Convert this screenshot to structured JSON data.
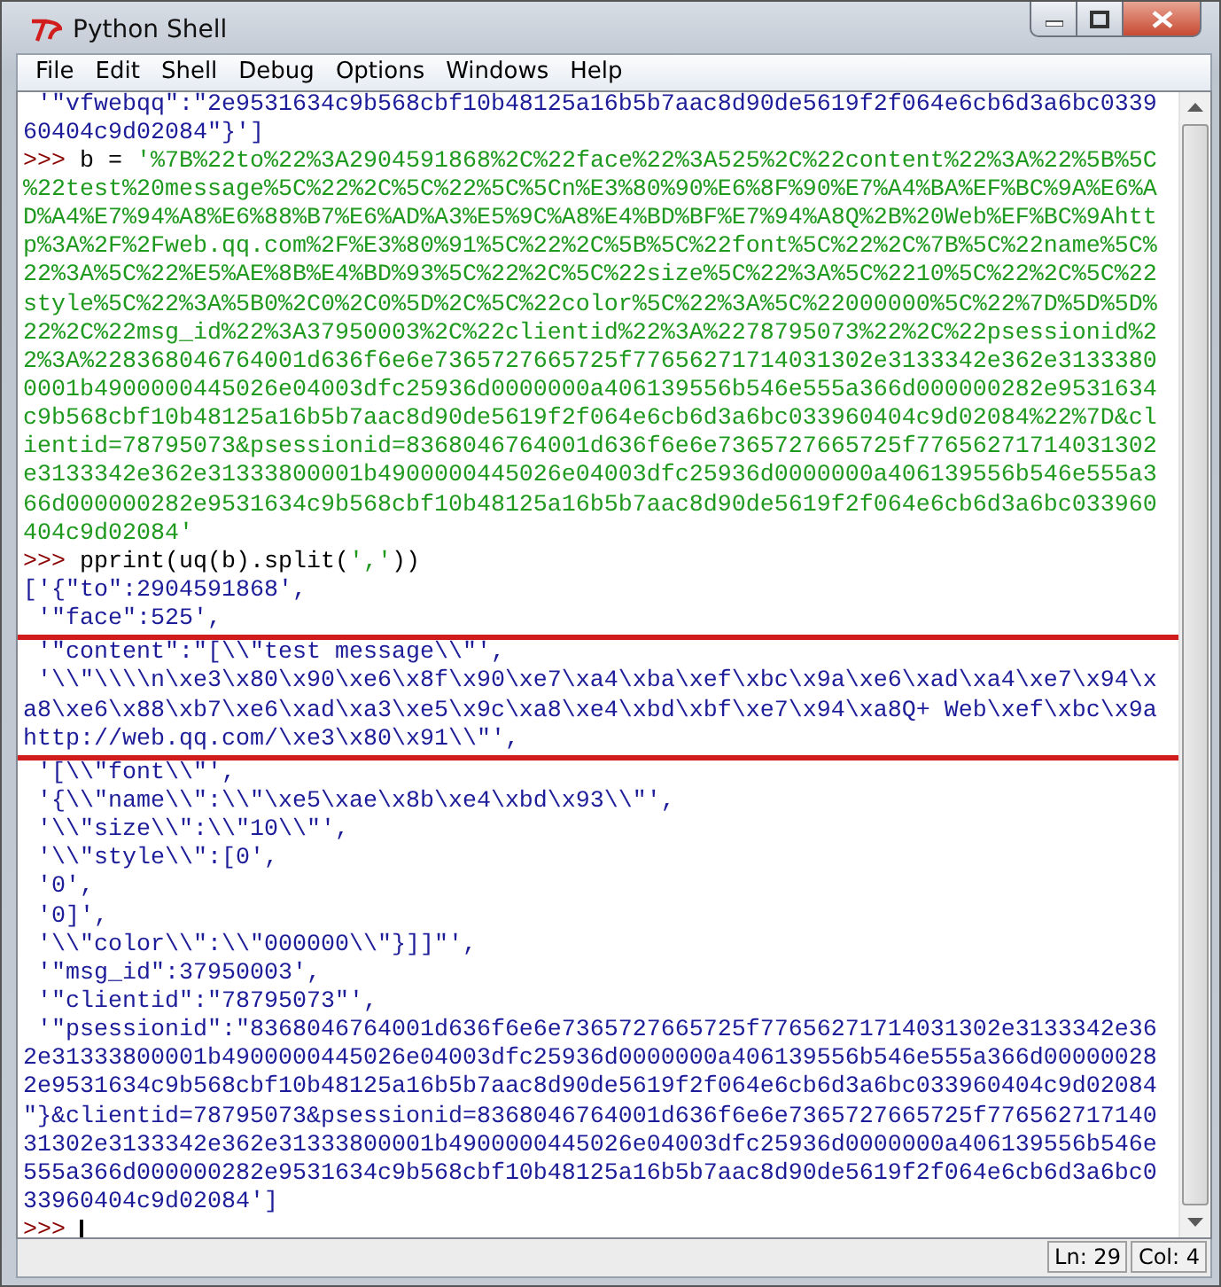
{
  "window": {
    "title": "Python Shell",
    "controls": [
      {
        "kind": "minimize"
      },
      {
        "kind": "maximize"
      },
      {
        "kind": "close"
      }
    ]
  },
  "menu": [
    {
      "label": "File"
    },
    {
      "label": "Edit"
    },
    {
      "label": "Shell"
    },
    {
      "label": "Debug"
    },
    {
      "label": "Options"
    },
    {
      "label": "Windows"
    },
    {
      "label": "Help"
    }
  ],
  "shell": {
    "lines": [
      {
        "parts": [
          {
            "kind": "stdout",
            "text": " '\"vfwebqq\":\"2e9531634c9b568cbf10b48125a16b5b7aac8d90de5619f2f064e6cb6d3a6bc0339"
          }
        ],
        "highlighted": false
      },
      {
        "parts": [
          {
            "kind": "stdout",
            "text": "60404c9d02084\"}']"
          }
        ],
        "highlighted": false
      },
      {
        "prompt": ">>>",
        "parts": [
          {
            "kind": "code",
            "text": "b = "
          },
          {
            "kind": "string",
            "text": "'%7B%22to%22%3A2904591868%2C%22face%22%3A525%2C%22content%22%3A%22%5B%5C"
          }
        ],
        "highlighted": false
      },
      {
        "parts": [
          {
            "kind": "string",
            "text": "%22test%20message%5C%22%2C%5C%22%5C%5Cn%E3%80%90%E6%8F%90%E7%A4%BA%EF%BC%9A%E6%A"
          }
        ],
        "highlighted": false
      },
      {
        "parts": [
          {
            "kind": "string",
            "text": "D%A4%E7%94%A8%E6%88%B7%E6%AD%A3%E5%9C%A8%E4%BD%BF%E7%94%A8Q%2B%20Web%EF%BC%9Ahtt"
          }
        ],
        "highlighted": false
      },
      {
        "parts": [
          {
            "kind": "string",
            "text": "p%3A%2F%2Fweb.qq.com%2F%E3%80%91%5C%22%2C%5B%5C%22font%5C%22%2C%7B%5C%22name%5C%"
          }
        ],
        "highlighted": false
      },
      {
        "parts": [
          {
            "kind": "string",
            "text": "22%3A%5C%22%E5%AE%8B%E4%BD%93%5C%22%2C%5C%22size%5C%22%3A%5C%2210%5C%22%2C%5C%22"
          }
        ],
        "highlighted": false
      },
      {
        "parts": [
          {
            "kind": "string",
            "text": "style%5C%22%3A%5B0%2C0%2C0%5D%2C%5C%22color%5C%22%3A%5C%22000000%5C%22%7D%5D%5D%"
          }
        ],
        "highlighted": false
      },
      {
        "parts": [
          {
            "kind": "string",
            "text": "22%2C%22msg_id%22%3A37950003%2C%22clientid%22%3A%2278795073%22%2C%22psessionid%2"
          }
        ],
        "highlighted": false
      },
      {
        "parts": [
          {
            "kind": "string",
            "text": "2%3A%228368046764001d636f6e6e7365727665725f77656271714031302e3133342e362e3133380"
          }
        ],
        "highlighted": false
      },
      {
        "parts": [
          {
            "kind": "string",
            "text": "0001b4900000445026e04003dfc25936d0000000a406139556b546e555a366d000000282e9531634"
          }
        ],
        "highlighted": false
      },
      {
        "parts": [
          {
            "kind": "string",
            "text": "c9b568cbf10b48125a16b5b7aac8d90de5619f2f064e6cb6d3a6bc033960404c9d02084%22%7D&cl"
          }
        ],
        "highlighted": false
      },
      {
        "parts": [
          {
            "kind": "string",
            "text": "ientid=78795073&psessionid=8368046764001d636f6e6e7365727665725f77656271714031302"
          }
        ],
        "highlighted": false
      },
      {
        "parts": [
          {
            "kind": "string",
            "text": "e3133342e362e31333800001b4900000445026e04003dfc25936d0000000a406139556b546e555a3"
          }
        ],
        "highlighted": false
      },
      {
        "parts": [
          {
            "kind": "string",
            "text": "66d000000282e9531634c9b568cbf10b48125a16b5b7aac8d90de5619f2f064e6cb6d3a6bc033960"
          }
        ],
        "highlighted": false
      },
      {
        "parts": [
          {
            "kind": "string",
            "text": "404c9d02084'"
          }
        ],
        "highlighted": false
      },
      {
        "prompt": ">>>",
        "parts": [
          {
            "kind": "code",
            "text": "pprint(uq(b).split("
          },
          {
            "kind": "string",
            "text": "','"
          },
          {
            "kind": "code",
            "text": "))"
          }
        ],
        "highlighted": false
      },
      {
        "parts": [
          {
            "kind": "stdout",
            "text": "['{\"to\":2904591868',"
          }
        ],
        "highlighted": false
      },
      {
        "parts": [
          {
            "kind": "stdout",
            "text": " '\"face\":525',"
          }
        ],
        "highlighted": false
      },
      {
        "parts": [
          {
            "kind": "stdout",
            "text": " '\"content\":\"[\\\\\"test message\\\\\"',"
          }
        ],
        "highlighted": true
      },
      {
        "parts": [
          {
            "kind": "stdout",
            "text": " '\\\\\"\\\\\\\\n\\xe3\\x80\\x90\\xe6\\x8f\\x90\\xe7\\xa4\\xba\\xef\\xbc\\x9a\\xe6\\xad\\xa4\\xe7\\x94\\x"
          }
        ],
        "highlighted": true
      },
      {
        "parts": [
          {
            "kind": "stdout",
            "text": "a8\\xe6\\x88\\xb7\\xe6\\xad\\xa3\\xe5\\x9c\\xa8\\xe4\\xbd\\xbf\\xe7\\x94\\xa8Q+ Web\\xef\\xbc\\x9a"
          }
        ],
        "highlighted": true
      },
      {
        "parts": [
          {
            "kind": "stdout",
            "text": "http://web.qq.com/\\xe3\\x80\\x91\\\\\"',"
          }
        ],
        "highlighted": true
      },
      {
        "parts": [
          {
            "kind": "stdout",
            "text": " '[\\\\\"font\\\\\"',"
          }
        ],
        "highlighted": false
      },
      {
        "parts": [
          {
            "kind": "stdout",
            "text": " '{\\\\\"name\\\\\":\\\\\"\\xe5\\xae\\x8b\\xe4\\xbd\\x93\\\\\"',"
          }
        ],
        "highlighted": false
      },
      {
        "parts": [
          {
            "kind": "stdout",
            "text": " '\\\\\"size\\\\\":\\\\\"10\\\\\"',"
          }
        ],
        "highlighted": false
      },
      {
        "parts": [
          {
            "kind": "stdout",
            "text": " '\\\\\"style\\\\\":[0',"
          }
        ],
        "highlighted": false
      },
      {
        "parts": [
          {
            "kind": "stdout",
            "text": " '0',"
          }
        ],
        "highlighted": false
      },
      {
        "parts": [
          {
            "kind": "stdout",
            "text": " '0]',"
          }
        ],
        "highlighted": false
      },
      {
        "parts": [
          {
            "kind": "stdout",
            "text": " '\\\\\"color\\\\\":\\\\\"000000\\\\\"}]]\"',"
          }
        ],
        "highlighted": false
      },
      {
        "parts": [
          {
            "kind": "stdout",
            "text": " '\"msg_id\":37950003',"
          }
        ],
        "highlighted": false
      },
      {
        "parts": [
          {
            "kind": "stdout",
            "text": " '\"clientid\":\"78795073\"',"
          }
        ],
        "highlighted": false
      },
      {
        "parts": [
          {
            "kind": "stdout",
            "text": " '\"psessionid\":\"8368046764001d636f6e6e7365727665725f77656271714031302e3133342e36"
          }
        ],
        "highlighted": false
      },
      {
        "parts": [
          {
            "kind": "stdout",
            "text": "2e31333800001b4900000445026e04003dfc25936d0000000a406139556b546e555a366d00000028"
          }
        ],
        "highlighted": false
      },
      {
        "parts": [
          {
            "kind": "stdout",
            "text": "2e9531634c9b568cbf10b48125a16b5b7aac8d90de5619f2f064e6cb6d3a6bc033960404c9d02084"
          }
        ],
        "highlighted": false
      },
      {
        "parts": [
          {
            "kind": "stdout",
            "text": "\"}&clientid=78795073&psessionid=8368046764001d636f6e6e7365727665725f776562717140"
          }
        ],
        "highlighted": false
      },
      {
        "parts": [
          {
            "kind": "stdout",
            "text": "31302e3133342e362e31333800001b4900000445026e04003dfc25936d0000000a406139556b546e"
          }
        ],
        "highlighted": false
      },
      {
        "parts": [
          {
            "kind": "stdout",
            "text": "555a366d000000282e9531634c9b568cbf10b48125a16b5b7aac8d90de5619f2f064e6cb6d3a6bc0"
          }
        ],
        "highlighted": false
      },
      {
        "parts": [
          {
            "kind": "stdout",
            "text": "33960404c9d02084']"
          }
        ],
        "highlighted": false
      },
      {
        "prompt": ">>>",
        "cursor": true,
        "highlighted": false
      }
    ]
  },
  "status_bar": [
    {
      "label": "Ln: 29"
    },
    {
      "label": "Col: 4"
    }
  ]
}
